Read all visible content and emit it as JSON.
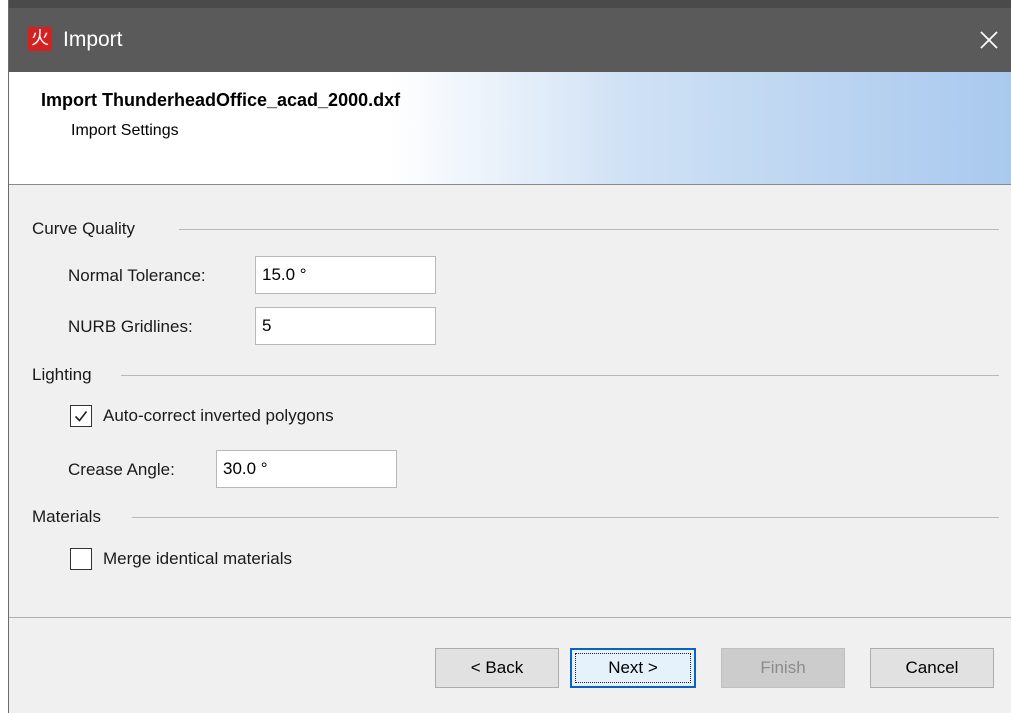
{
  "window": {
    "title": "Import",
    "app_icon_glyph": "火",
    "close_glyph": "✕"
  },
  "header": {
    "title": "Import ThunderheadOffice_acad_2000.dxf",
    "subtitle": "Import Settings"
  },
  "sections": {
    "curve_quality": {
      "label": "Curve Quality",
      "normal_tolerance": {
        "label": "Normal Tolerance:",
        "value": "15.0 °"
      },
      "nurb_gridlines": {
        "label": "NURB Gridlines:",
        "value": "5"
      }
    },
    "lighting": {
      "label": "Lighting",
      "auto_correct": {
        "label": "Auto-correct inverted polygons",
        "checked": true
      },
      "crease_angle": {
        "label": "Crease Angle:",
        "value": "30.0 °"
      }
    },
    "materials": {
      "label": "Materials",
      "merge_identical": {
        "label": "Merge identical materials",
        "checked": false
      }
    }
  },
  "buttons": {
    "back": "< Back",
    "next": "Next >",
    "finish": "Finish",
    "cancel": "Cancel"
  },
  "colors": {
    "titlebar": "#5a5a5a",
    "app_icon": "#d32222",
    "header_gradient_end": "#a9c9ee",
    "default_button_border": "#0a63c4"
  }
}
